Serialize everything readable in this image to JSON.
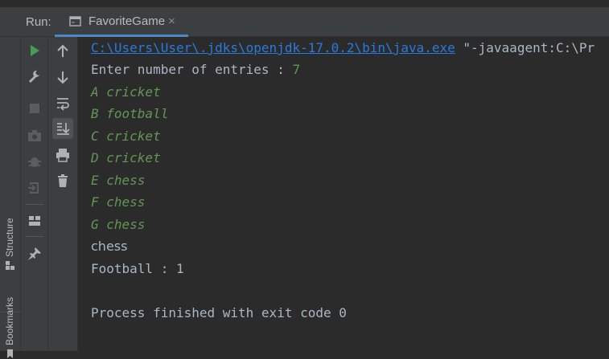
{
  "header": {
    "run_label": "Run:",
    "tab_label": "FavoriteGame",
    "tab_close": "×"
  },
  "side_tools": {
    "structure": "Structure",
    "bookmarks": "Bookmarks"
  },
  "toolbar_icons": [
    "run-icon",
    "wrench-icon",
    "stop-icon",
    "camera-icon",
    "bug-icon",
    "exit-icon",
    "layout-icon",
    "pin-icon",
    "up-arrow-icon",
    "down-arrow-icon",
    "soft-wrap-icon",
    "scroll-to-end-icon",
    "print-icon",
    "trash-icon"
  ],
  "console": {
    "command_link": "C:\\Users\\User\\.jdks\\openjdk-17.0.2\\bin\\java.exe",
    "command_rest": " \"-javaagent:C:\\Pr",
    "prompt": "Enter number of entries : ",
    "prompt_input": "7",
    "entries": [
      "A cricket",
      "B football",
      "C cricket",
      "D cricket",
      "E chess",
      "F chess",
      "G chess"
    ],
    "result": "chess",
    "football_count": "Football : 1",
    "finish": "Process finished with exit code 0"
  },
  "colors": {
    "link": "#287bde",
    "input": "#629755",
    "text": "#a9b7c6",
    "run_green": "#499c54",
    "accent": "#4a88c7"
  }
}
